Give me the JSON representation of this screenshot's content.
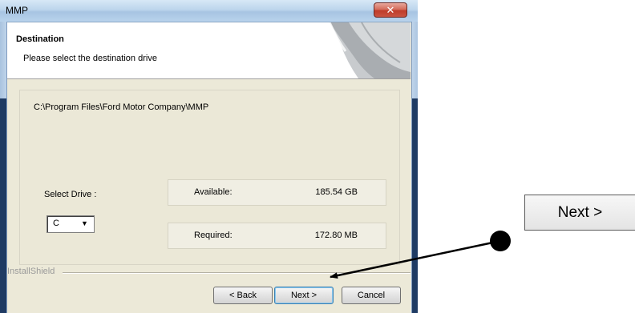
{
  "window": {
    "title": "MMP",
    "close_glyph": "✕"
  },
  "header": {
    "title": "Destination",
    "subtitle": "Please select the destination drive"
  },
  "destination": {
    "path": "C:\\Program Files\\Ford Motor Company\\MMP"
  },
  "drive": {
    "label": "Select Drive :",
    "selected": "C",
    "arrow_glyph": "▼"
  },
  "space": {
    "available_label": "Available:",
    "available_value": "185.54 GB",
    "required_label": "Required:",
    "required_value": "172.80 MB"
  },
  "footer": {
    "brand": "InstallShield",
    "back_label": "< Back",
    "next_label": "Next >",
    "cancel_label": "Cancel"
  },
  "callout": {
    "label": "Next >"
  },
  "colors": {
    "title_bar": "#bcd5ec",
    "close_button": "#c94b38",
    "frame_dark": "#1f3b63",
    "default_button_border": "#3c7fb1"
  }
}
